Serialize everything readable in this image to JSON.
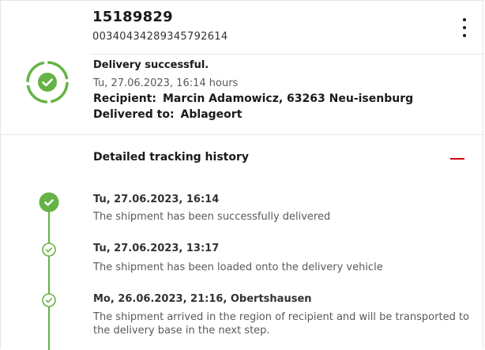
{
  "shipment": {
    "id": "15189829",
    "tracking_number": "00340434289345792614"
  },
  "status": {
    "title": "Delivery successful.",
    "datetime": "Tu, 27.06.2023, 16:14 hours",
    "recipient_label": "Recipient:",
    "recipient_value": "Marcin Adamowicz, 63263 Neu-isenburg",
    "delivered_to_label": "Delivered to:",
    "delivered_to_value": "Ablageort"
  },
  "history": {
    "title": "Detailed tracking history",
    "events": [
      {
        "date": "Tu, 27.06.2023, 16:14",
        "description": "The shipment has been successfully delivered"
      },
      {
        "date": "Tu, 27.06.2023, 13:17",
        "description": "The shipment has been loaded onto the delivery vehicle"
      },
      {
        "date": "Mo, 26.06.2023, 21:16, Obertshausen",
        "description": "The shipment arrived in the region of recipient and will be transported to the delivery base in the next step."
      }
    ]
  },
  "icons": {
    "status": "delivered-check-icon",
    "menu": "kebab-menu-icon",
    "collapse": "minus-icon",
    "timeline": "check-circle-icon"
  },
  "colors": {
    "success_green": "#66b345",
    "accent_red": "#d40511"
  }
}
